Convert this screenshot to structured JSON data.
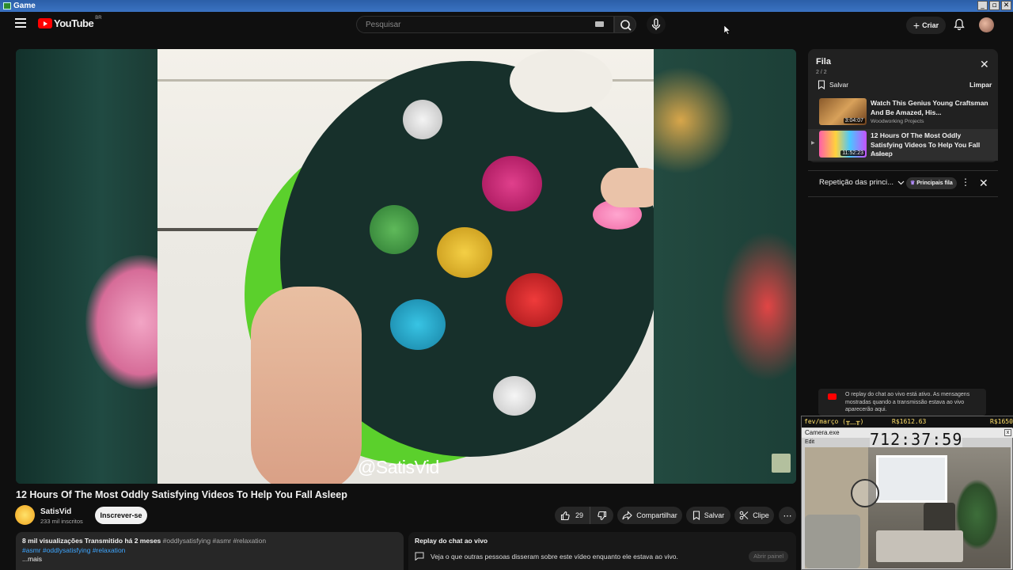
{
  "window": {
    "title": "Game",
    "controls": [
      "_",
      "▫",
      "✕"
    ]
  },
  "header": {
    "logo_text": "YouTube",
    "country_code": "BR",
    "search_placeholder": "Pesquisar",
    "create_label": "Criar"
  },
  "video": {
    "watermark": "@SatisVid",
    "title": "12 Hours Of The Most Oddly Satisfying Videos To Help You Fall Asleep",
    "channel": "SatisVid",
    "subscribers": "233 mil inscritos",
    "subscribe_label": "Inscrever-se",
    "likes": "29",
    "share_label": "Compartilhar",
    "save_label": "Salvar",
    "clip_label": "Clipe",
    "more_label": "⋯"
  },
  "description": {
    "stats": "8 mil visualizações  Transmitido há 2 meses",
    "tags_gray": "#oddlysatisfying #asmr #relaxation",
    "tags_blue": "#asmr #oddlysatisfying #relaxation",
    "more": "...mais"
  },
  "chat_replay_box": {
    "title": "Replay do chat ao vivo",
    "text": "Veja o que outras pessoas disseram sobre este vídeo enquanto ele estava ao vivo.",
    "open_panel": "Abrir painel"
  },
  "queue": {
    "title": "Fila",
    "count": "2 / 2",
    "save_label": "Salvar",
    "clear_label": "Limpar",
    "items": [
      {
        "title": "Watch This Genius Young Craftsman And Be Amazed, His...",
        "channel": "Woodworking Projects",
        "duration": "3:04:07"
      },
      {
        "title": "12 Hours Of The Most Oddly Satisfying Videos To Help You Fall Asleep",
        "channel": "SatisVid",
        "duration": "11:52:23"
      }
    ]
  },
  "chat_panel": {
    "mode": "Repetição das princi...",
    "badge": "Principais fila",
    "notice": "O replay do chat ao vivo está ativo. As mensagens mostradas quando a transmissão estava ao vivo aparecerão aqui."
  },
  "overlay": {
    "ticker_left": "fev/março (╥﹏╥)",
    "ticker_mid": "R$1612.63",
    "ticker_right": "R$1650",
    "window_title": "Camera.exe",
    "file_menu": "Edit",
    "clock": "712:37:59"
  },
  "colors": {
    "accent": "#ff0000",
    "background": "#0f0f0f",
    "link": "#3ea6ff"
  }
}
